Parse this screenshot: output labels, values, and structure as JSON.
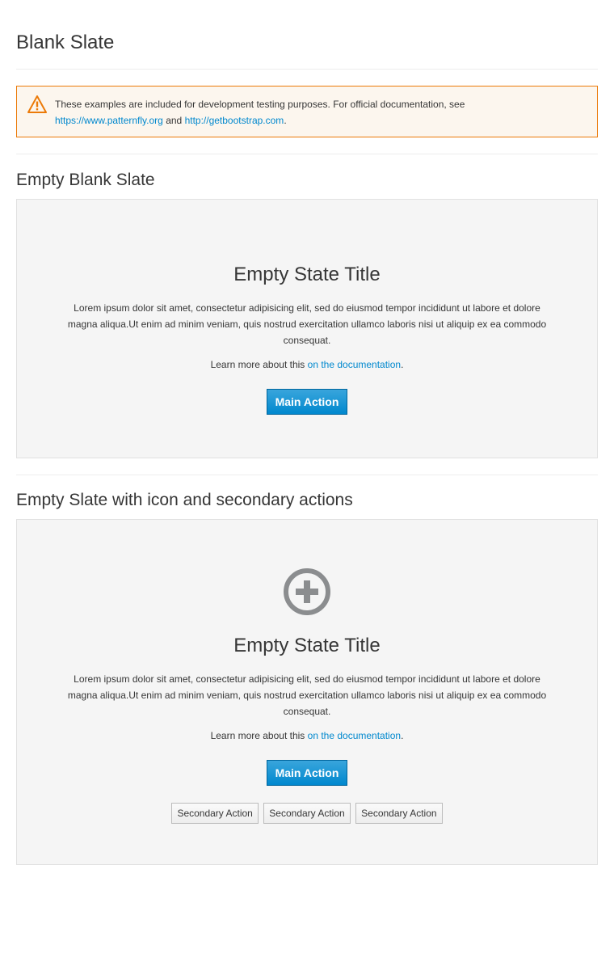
{
  "page": {
    "title": "Blank Slate"
  },
  "alert": {
    "icon": "warning-triangle-icon",
    "text_before": "These examples are included for development testing purposes. For official documentation, see",
    "link1": "https://www.patternfly.org",
    "and_text": "and",
    "link2": "http://getbootstrap.com",
    "end_text": ".",
    "border_color": "#ec7a08",
    "background_color": "#fcf6ee"
  },
  "section1": {
    "title": "Empty Blank Slate",
    "empty_title": "Empty State Title",
    "body": "Lorem ipsum dolor sit amet, consectetur adipisicing elit, sed do eiusmod tempor incididunt ut labore et dolore magna aliqua.Ut enim ad minim veniam, quis nostrud exercitation ullamco laboris nisi ut aliquip ex ea commodo consequat.",
    "learn_prefix": "Learn more about this",
    "learn_link": "on the documentation",
    "learn_suffix": ".",
    "main_action": "Main Action"
  },
  "section2": {
    "title": "Empty Slate with icon and secondary actions",
    "icon": "add-circle-icon",
    "empty_title": "Empty State Title",
    "body": "Lorem ipsum dolor sit amet, consectetur adipisicing elit, sed do eiusmod tempor incididunt ut labore et dolore magna aliqua.Ut enim ad minim veniam, quis nostrud exercitation ullamco laboris nisi ut aliquip ex ea commodo consequat.",
    "learn_prefix": "Learn more about this",
    "learn_link": "on the documentation",
    "learn_suffix": ".",
    "main_action": "Main Action",
    "secondary_actions": [
      "Secondary Action",
      "Secondary Action",
      "Secondary Action"
    ]
  },
  "colors": {
    "primary": "#0088ce",
    "slate_background": "#f5f5f5",
    "icon_gray": "#8b8d8f"
  }
}
